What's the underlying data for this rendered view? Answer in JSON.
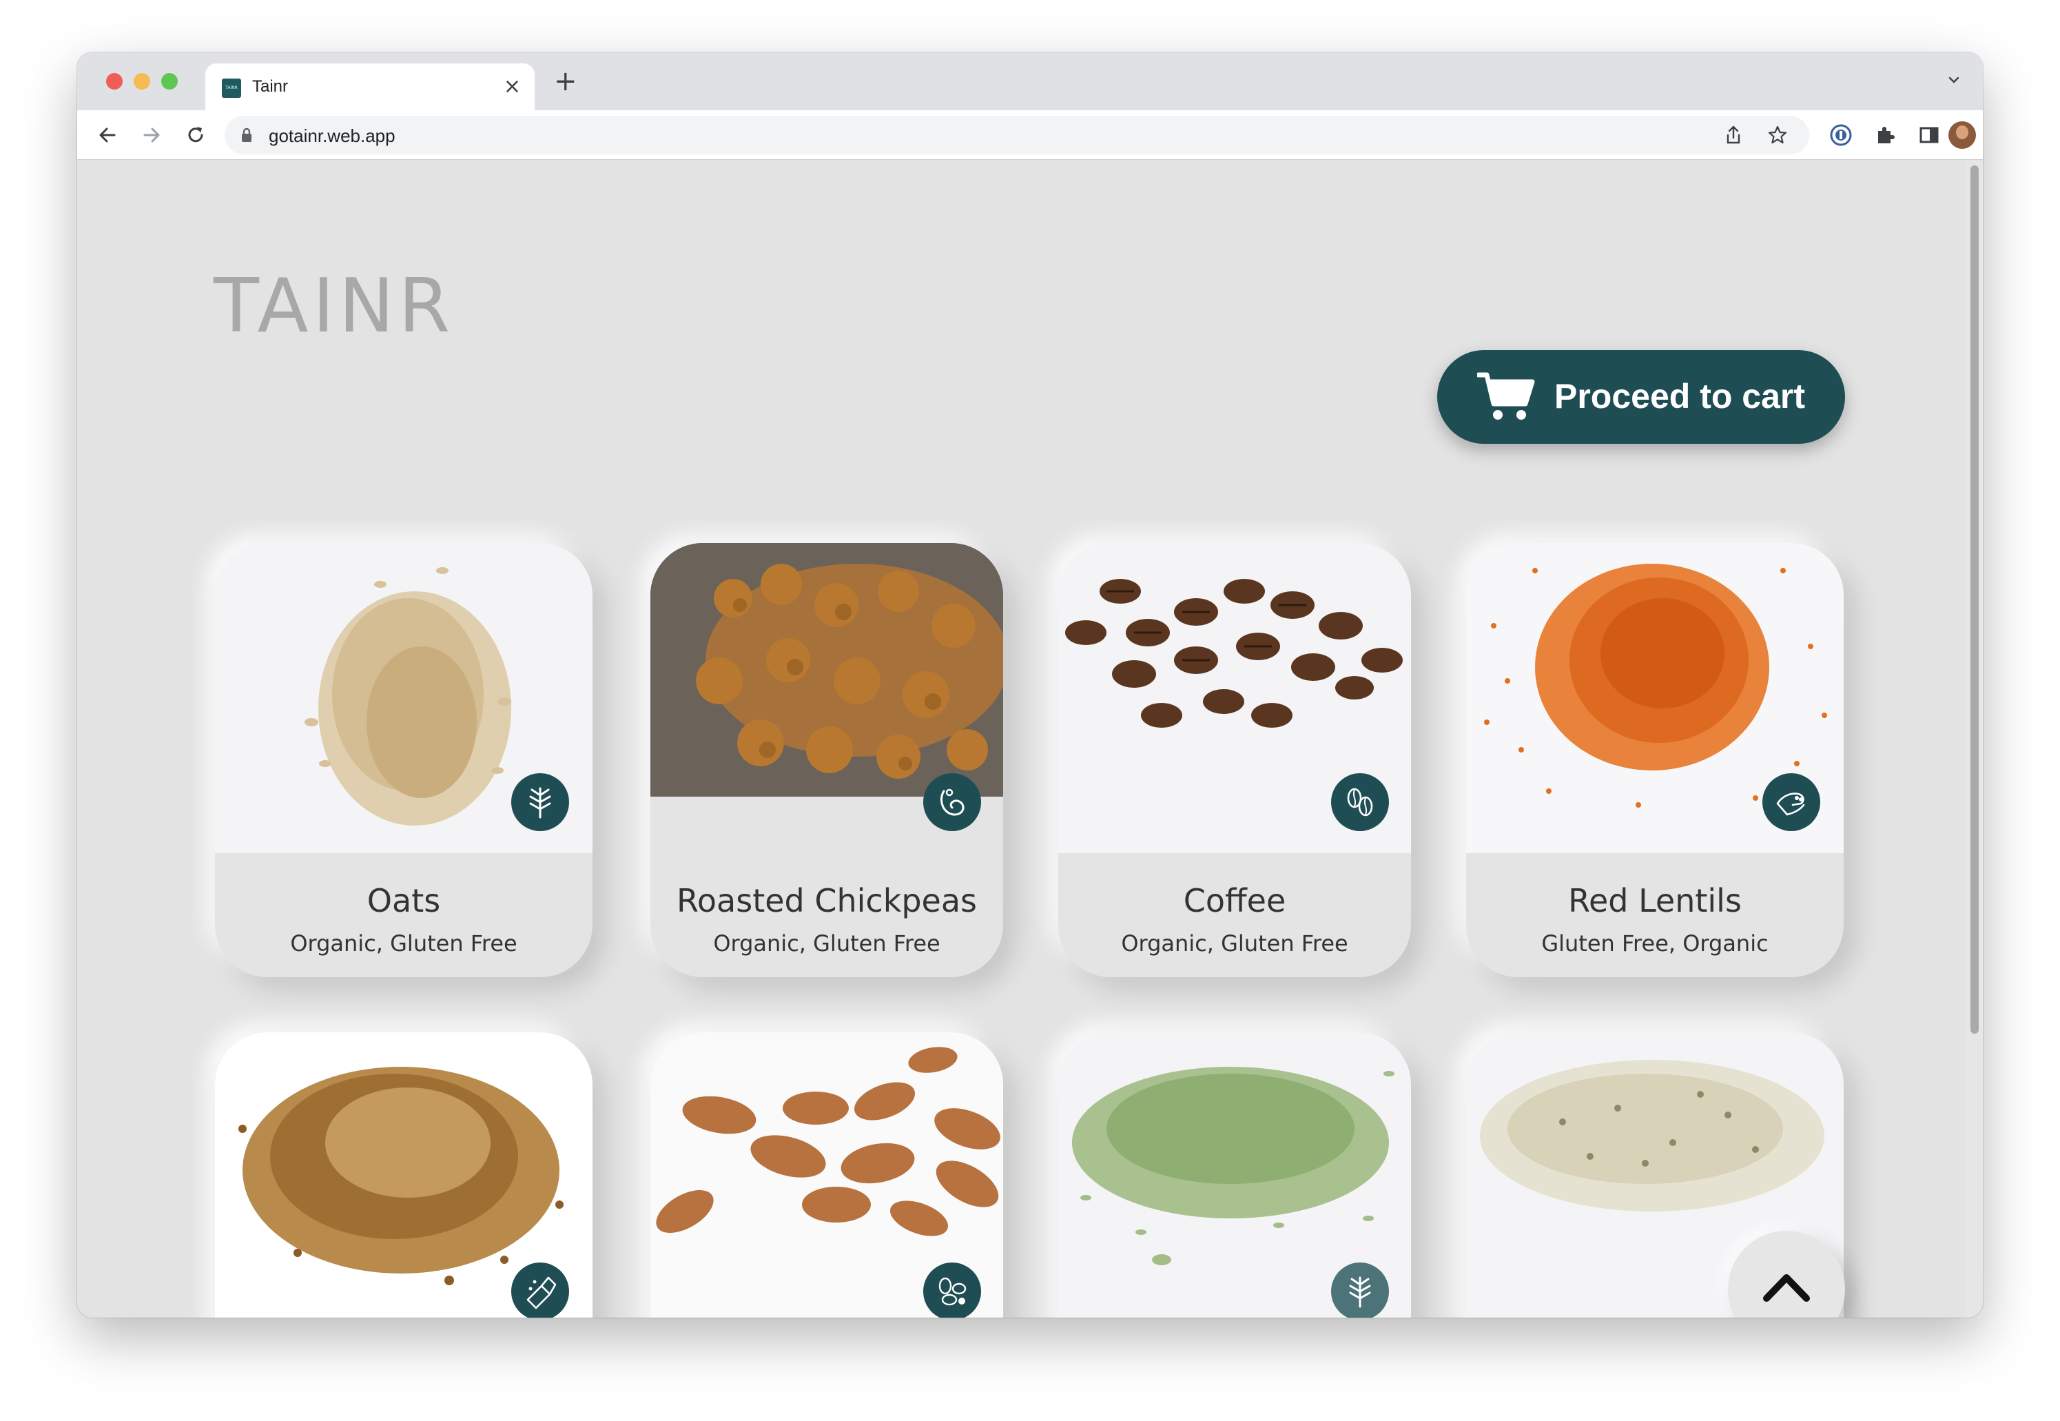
{
  "browser": {
    "tab_title": "Tainr",
    "favicon_text": "TAINR",
    "tab_close": "×",
    "new_tab": "+",
    "url": "gotainr.web.app",
    "icons": [
      "back-icon",
      "forward-icon",
      "reload-icon",
      "lock-icon",
      "share-icon",
      "star-icon",
      "password-manager-icon",
      "extensions-icon",
      "side-panel-icon",
      "profile-avatar",
      "more-icon",
      "tab-dropdown-icon"
    ]
  },
  "page": {
    "logo": "TAINR",
    "cart_button_label": "Proceed to cart",
    "cart_icon": "cart-icon",
    "scroll_top_icon": "chevron-up-icon",
    "accent_color": "#1f4d54",
    "background_color": "#e3e3e3"
  },
  "products": [
    {
      "name": "Oats",
      "tags": "Organic, Gluten Free",
      "badge_icon": "wheat-icon"
    },
    {
      "name": "Roasted Chickpeas",
      "tags": "Organic, Gluten Free",
      "badge_icon": "chickpea-icon"
    },
    {
      "name": "Coffee",
      "tags": "Organic, Gluten Free",
      "badge_icon": "coffee-bean-icon"
    },
    {
      "name": "Red Lentils",
      "tags": "Gluten Free, Organic",
      "badge_icon": "lentil-hand-icon"
    },
    {
      "name": "",
      "tags": "",
      "badge_icon": "granola-scoop-icon"
    },
    {
      "name": "",
      "tags": "",
      "badge_icon": "nuts-icon"
    },
    {
      "name": "",
      "tags": "",
      "badge_icon": "wheat-icon"
    },
    {
      "name": "",
      "tags": "",
      "badge_icon": ""
    }
  ]
}
